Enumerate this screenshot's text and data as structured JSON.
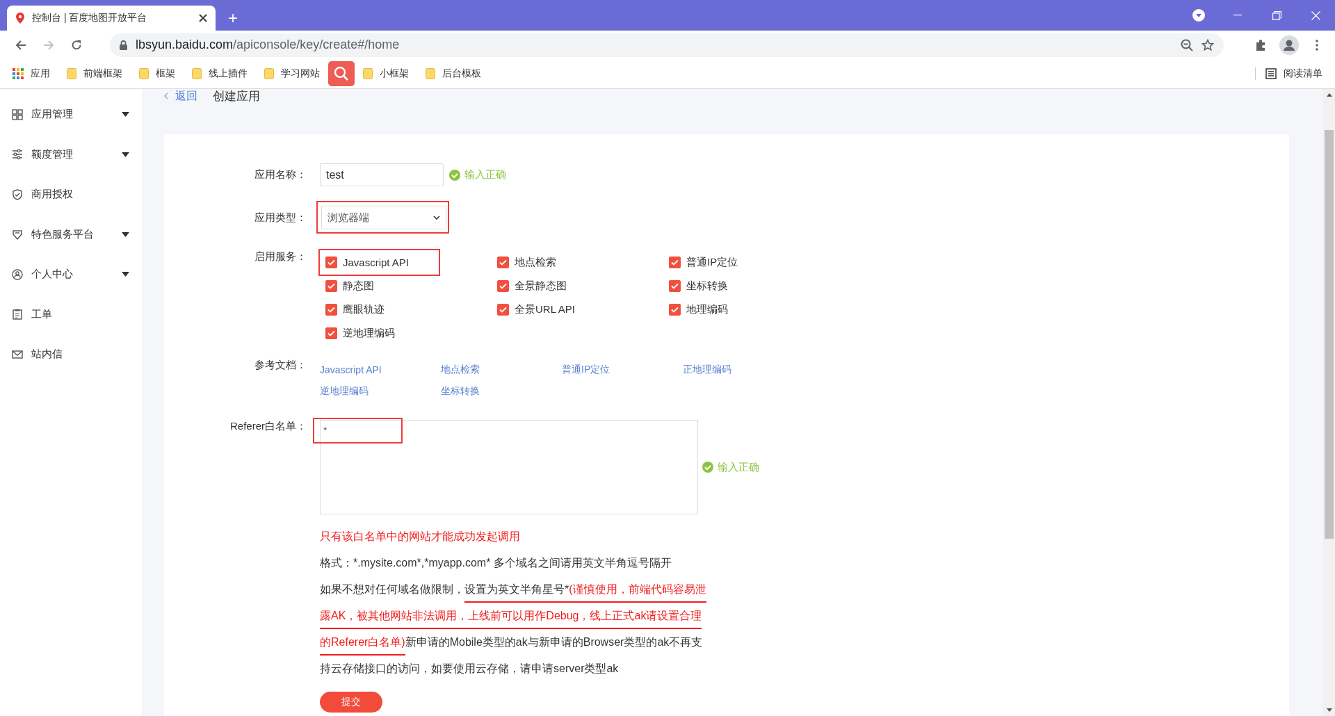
{
  "browser": {
    "tab_title": "控制台 | 百度地图开放平台",
    "new_tab": "+",
    "url_host": "lbsyun.baidu.com",
    "url_path": "/apiconsole/key/create#/home",
    "reading_list": "阅读清单"
  },
  "bookmarks": [
    {
      "label": "应用",
      "kind": "apps"
    },
    {
      "label": "前端框架",
      "kind": "folder"
    },
    {
      "label": "框架",
      "kind": "folder"
    },
    {
      "label": "线上插件",
      "kind": "folder"
    },
    {
      "label": "学习网站",
      "kind": "folder"
    },
    {
      "label": "小框架",
      "kind": "folder"
    },
    {
      "label": "后台模板",
      "kind": "folder"
    }
  ],
  "sidebar": {
    "items": [
      {
        "label": "应用管理",
        "kind": "group",
        "expanded": false
      },
      {
        "label": "额度管理",
        "kind": "group",
        "expanded": false
      },
      {
        "label": "商用授权",
        "kind": "link"
      },
      {
        "label": "特色服务平台",
        "kind": "group",
        "expanded": false
      },
      {
        "label": "个人中心",
        "kind": "group",
        "expanded": false
      },
      {
        "label": "工单",
        "kind": "link"
      },
      {
        "label": "站内信",
        "kind": "link"
      }
    ]
  },
  "page_header": {
    "back_link": "返回",
    "title": "创建应用"
  },
  "form": {
    "name": {
      "label": "应用名称：",
      "value": "test",
      "validation": "输入正确"
    },
    "type": {
      "label": "应用类型：",
      "value": "浏览器端",
      "annotated": true
    },
    "services": {
      "label": "启用服务：",
      "items": [
        {
          "label": "Javascript API",
          "checked": true,
          "annotated": true
        },
        {
          "label": "地点检索",
          "checked": true,
          "annotated": false
        },
        {
          "label": "普通IP定位",
          "checked": true,
          "annotated": false
        },
        {
          "label": "静态图",
          "checked": true,
          "annotated": false
        },
        {
          "label": "全景静态图",
          "checked": true,
          "annotated": false
        },
        {
          "label": "坐标转换",
          "checked": true,
          "annotated": false
        },
        {
          "label": "鹰眼轨迹",
          "checked": true,
          "annotated": false
        },
        {
          "label": "全景URL API",
          "checked": true,
          "annotated": false
        },
        {
          "label": "地理编码",
          "checked": true,
          "annotated": false
        },
        {
          "label": "逆地理编码",
          "checked": true,
          "annotated": false
        }
      ]
    },
    "docs": {
      "label": "参考文档：",
      "links": [
        "Javascript API",
        "地点检索",
        "普通IP定位",
        "正地理编码",
        "逆地理编码",
        "坐标转换"
      ]
    },
    "referer": {
      "label": "Referer白名单：",
      "value": "*",
      "annotated": true,
      "validation": "输入正确"
    },
    "notes": [
      {
        "kind": "warning",
        "text": "只有该白名单中的网站才能成功发起调用"
      },
      {
        "kind": "plain",
        "text": "格式：*.mysite.com*,*myapp.com* 多个域名之间请用英文半角逗号隔开"
      },
      {
        "kind": "segments",
        "segments": [
          {
            "text": "如果不想对任何域名做限制，",
            "red": false,
            "underlined": false
          },
          {
            "text": "设置为英文半角星号*",
            "red": false,
            "underlined": true
          },
          {
            "text": "(谨慎使用，前端代码容易泄露AK，被其他网站非法调用，上线前可以用作Debug，线上正式ak请设置合理的Referer白名单)",
            "red": true,
            "underlined": true
          },
          {
            "text": "新申请的Mobile类型的ak与新申请的Browser类型的ak不再支持云存储接口的访问，如要使用云存储，请申请server类型ak",
            "red": false,
            "underlined": false
          }
        ]
      }
    ],
    "submit": "提交"
  }
}
